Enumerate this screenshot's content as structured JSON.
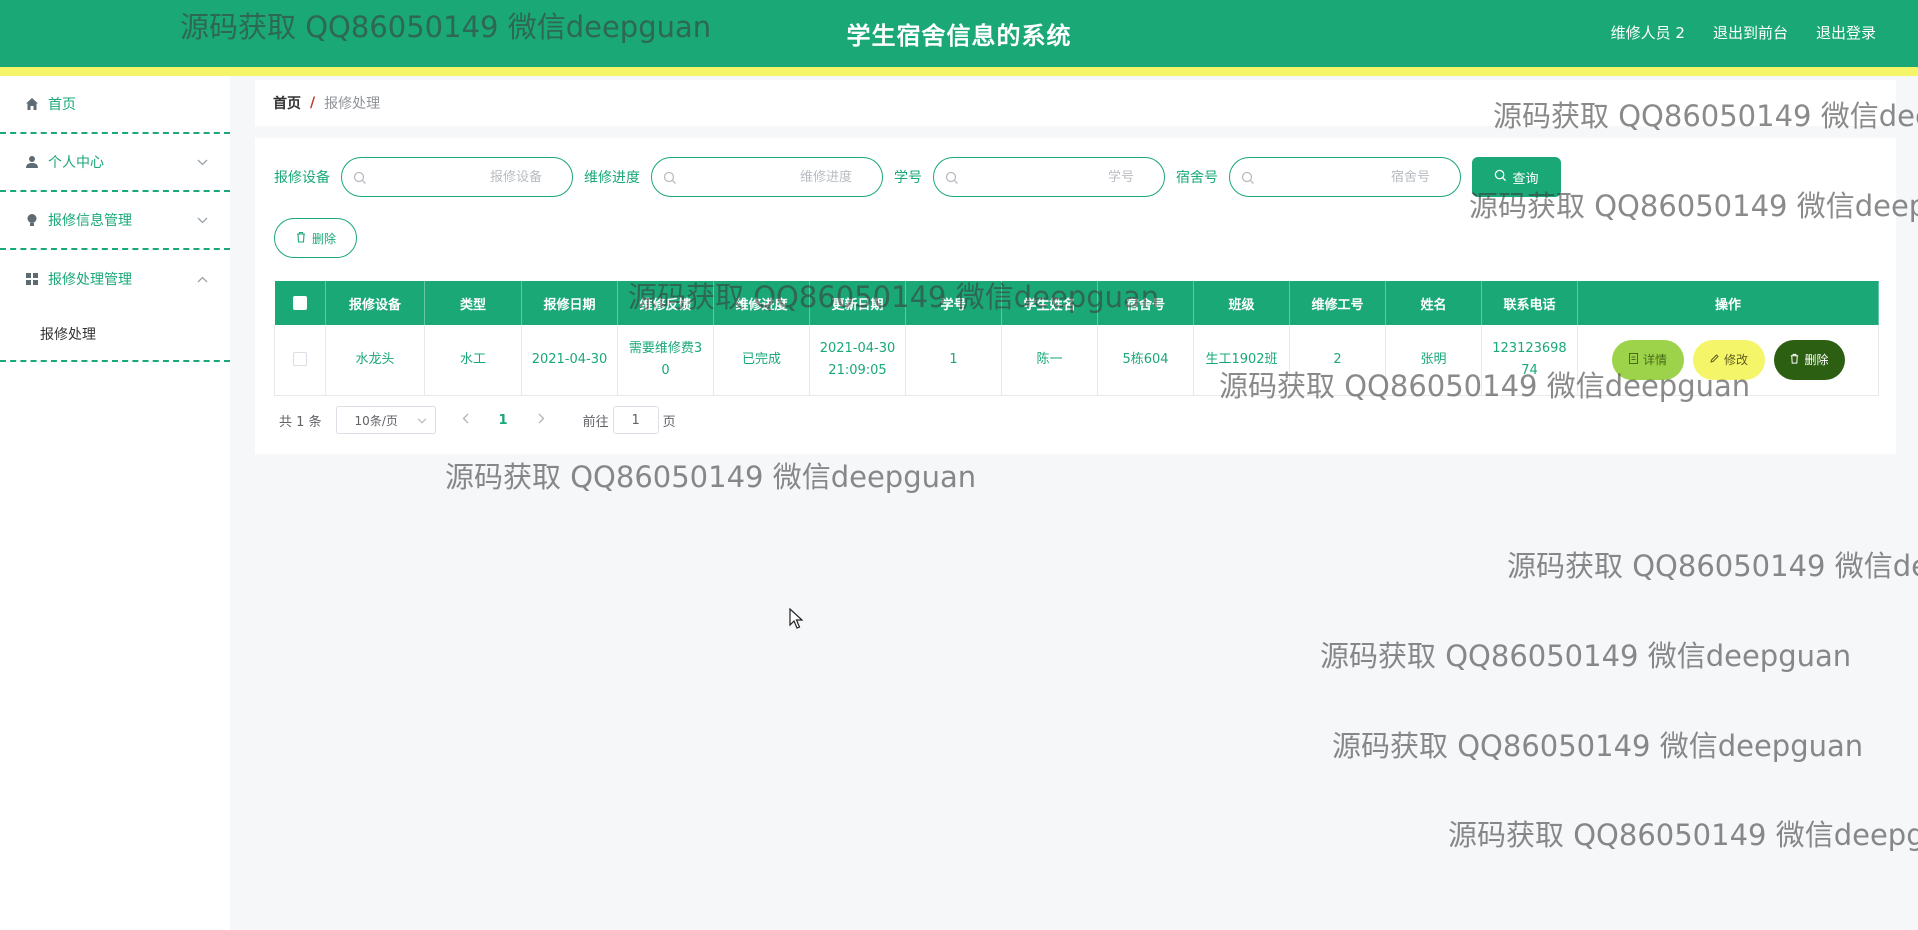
{
  "header": {
    "title": "学生宿舍信息的系统",
    "links": [
      "维修人员 2",
      "退出到前台",
      "退出登录"
    ]
  },
  "sidebar": {
    "items": [
      {
        "label": "首页",
        "icon": "home-icon"
      },
      {
        "label": "个人中心",
        "icon": "user-icon"
      },
      {
        "label": "报修信息管理",
        "icon": "bulb-icon"
      },
      {
        "label": "报修处理管理",
        "icon": "grid-icon"
      }
    ],
    "submenu": "报修处理"
  },
  "breadcrumb": {
    "home": "首页",
    "separator": "/",
    "current": "报修处理"
  },
  "search": {
    "fields": [
      {
        "label": "报修设备",
        "placeholder": "报修设备"
      },
      {
        "label": "维修进度",
        "placeholder": "维修进度"
      },
      {
        "label": "学号",
        "placeholder": "学号"
      },
      {
        "label": "宿舍号",
        "placeholder": "宿舍号"
      }
    ],
    "query_label": "查询"
  },
  "actions": {
    "delete_label": "删除"
  },
  "table": {
    "headers": [
      "报修设备",
      "类型",
      "报修日期",
      "维修反馈",
      "维修进度",
      "更新日期",
      "学号",
      "学生姓名",
      "宿舍号",
      "班级",
      "维修工号",
      "姓名",
      "联系电话",
      "操作"
    ],
    "rows": [
      [
        "水龙头",
        "水工",
        "2021-04-30",
        "需要维修费30",
        "已完成",
        "2021-04-30 21:09:05",
        "1",
        "陈一",
        "5栋604",
        "生工1902班",
        "2",
        "张明",
        "12312369874"
      ]
    ],
    "row_ops": [
      "详情",
      "修改",
      "删除"
    ]
  },
  "pagination": {
    "total": "共 1 条",
    "page_size": "10条/页",
    "current_page": "1",
    "goto_label": "前往",
    "goto_value": "1",
    "page_unit": "页"
  },
  "watermark": "源码获取 QQ86050149 微信deepguan",
  "colors": {
    "primary": "#1aa877",
    "stripe": "#f5f56a",
    "detail_btn": "#9cd34a",
    "edit_btn": "#f5f56a",
    "delete_btn": "#2d5f12"
  }
}
